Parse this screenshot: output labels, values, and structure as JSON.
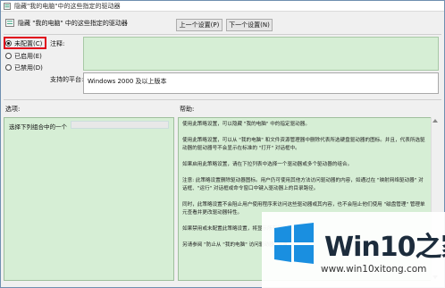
{
  "window": {
    "title": "隐藏\"我的电脑\"中的这些指定的驱动器"
  },
  "header": {
    "policy_name": "隐藏 \"我的电脑\" 中的这些指定的驱动器",
    "prev_button": "上一个设置(P)",
    "next_button": "下一个设置(N)"
  },
  "state": {
    "options": [
      {
        "label": "未配置(C)",
        "selected": true
      },
      {
        "label": "已启用(E)",
        "selected": false
      },
      {
        "label": "已禁用(D)",
        "selected": false
      }
    ],
    "highlight_color": "#e0001b"
  },
  "comment": {
    "label": "注释:"
  },
  "platform": {
    "label": "支持的平台:",
    "value": "Windows 2000 及以上版本"
  },
  "options_section": {
    "label": "选项:",
    "prompt": "选择下列组合中的一个"
  },
  "help_section": {
    "label": "帮助:",
    "paragraphs": [
      "使用此策略设置，可以隐藏 \"我的电脑\" 中的指定驱动器。",
      "使用此策略设置，可以从 \"我的电脑\" 和文件资源管理器中删除代表所选硬盘驱动器的图标。并且，代表所选驱动器的驱动器号不会显示在标准的 \"打开\" 对话框中。",
      "如果启用此策略设置，请在下拉列表中选择一个驱动器或多个驱动器的组合。",
      "注意: 此策略设置删除驱动器图标。用户仍可使用其他方法访问驱动器的内容，如通过在 \"映射网络驱动器\" 对话框、\"运行\" 对话框或命令窗口中键入驱动器上的目录路径。",
      "同时，此策略设置不会阻止用户使用程序来访问这些驱动器或其内容，也不会阻止他们使用 \"磁盘管理\" 管理单元查看并更改驱动器特性。",
      "如果禁用或未配置此策略设置，将显示所有驱动器。",
      "另请参阅 \"防止从 \"我的电脑\" 访问驱动器\" 设置。"
    ]
  },
  "watermark": {
    "brand": "Win10之家",
    "url": "www.win10xitong.com",
    "logo_color": "#1a8fe0"
  }
}
